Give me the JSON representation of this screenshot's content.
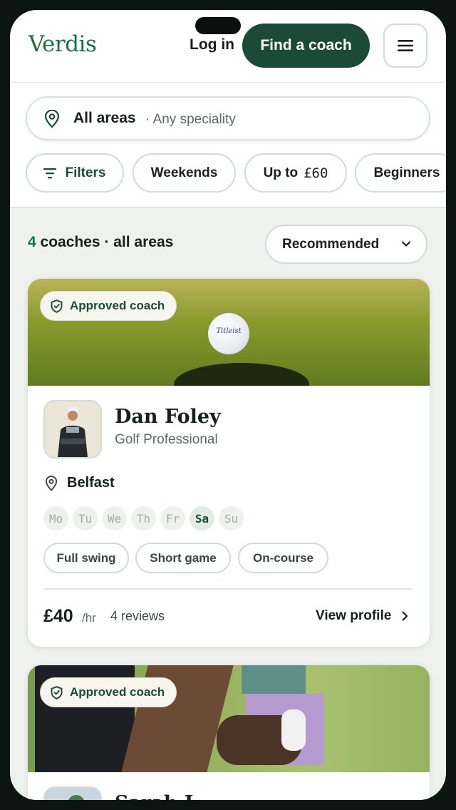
{
  "brand": {
    "logo": "Verdis",
    "accent": "#1f6e48",
    "dark": "#1c4a38"
  },
  "header": {
    "login_label": "Log in",
    "cta_label": "Find a coach",
    "menu_icon": "hamburger-icon"
  },
  "search": {
    "location": "All areas",
    "speciality": "· Any speciality",
    "icon": "map-pin-icon"
  },
  "chips": [
    {
      "label": "Filters",
      "icon": "filter-icon"
    },
    {
      "label": "Weekends"
    },
    {
      "label": "Up to",
      "amount": "£60"
    },
    {
      "label": "Beginners"
    }
  ],
  "results": {
    "count": "4",
    "count_suffix": "coaches · all areas",
    "sort_label": "Recommended"
  },
  "coaches": [
    {
      "badge": "Approved coach",
      "name": "Dan Foley",
      "role": "Golf Professional",
      "location": "Belfast",
      "days": [
        "Mo",
        "Tu",
        "We",
        "Th",
        "Fr",
        "Sa",
        "Su"
      ],
      "available_days": [
        "Sa"
      ],
      "tags": [
        "Full swing",
        "Short game",
        "On-course"
      ],
      "price": "£40",
      "price_unit": "/hr",
      "reviews": "4 reviews",
      "cta": "View profile",
      "ball_brand": "Titleist"
    },
    {
      "badge": "Approved coach",
      "name": "Sarah L"
    }
  ]
}
